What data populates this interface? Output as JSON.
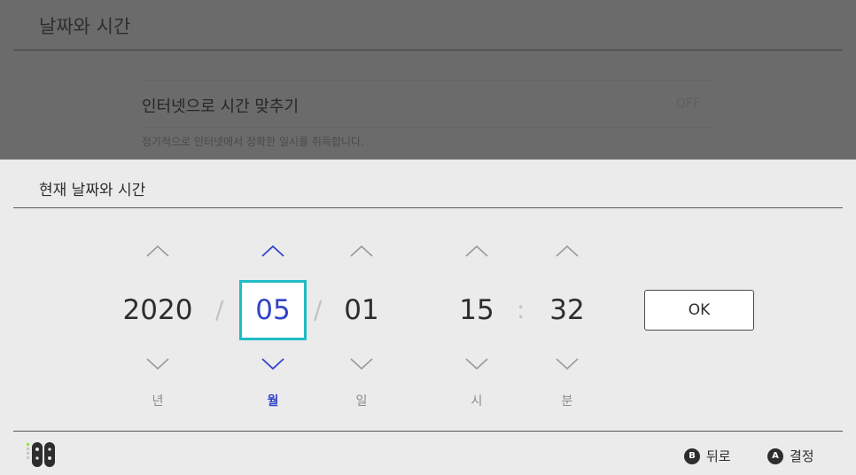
{
  "background": {
    "title": "날짜와 시간",
    "setting_label": "인터넷으로 시간 맞추기",
    "setting_value": "OFF",
    "setting_description": "정기적으로 인터넷에서 정확한 일시를 취득합니다."
  },
  "panel": {
    "title": "현재 날짜와 시간",
    "date_separator": "/",
    "time_separator": ":",
    "fields": [
      {
        "value": "2020",
        "unit": "년",
        "up_icon": "chevron-up-icon",
        "down_icon": "chevron-down-icon"
      },
      {
        "value": "05",
        "unit": "월",
        "selected": true,
        "up_icon": "chevron-up-icon",
        "down_icon": "chevron-down-icon"
      },
      {
        "value": "01",
        "unit": "일",
        "up_icon": "chevron-up-icon",
        "down_icon": "chevron-down-icon"
      },
      {
        "value": "15",
        "unit": "시",
        "up_icon": "chevron-up-icon",
        "down_icon": "chevron-down-icon"
      },
      {
        "value": "32",
        "unit": "분",
        "up_icon": "chevron-up-icon",
        "down_icon": "chevron-down-icon"
      }
    ],
    "ok_label": "OK"
  },
  "footer": {
    "controller_icon": "joy-con-controller-icon",
    "back": {
      "key": "B",
      "label": "뒤로"
    },
    "confirm": {
      "key": "A",
      "label": "결정"
    }
  },
  "colors": {
    "accent_selected": "#3244c8",
    "selection_border": "#1fbcc6",
    "panel_background": "#ebebeb",
    "dim_overlay": "#6b6b6b"
  }
}
